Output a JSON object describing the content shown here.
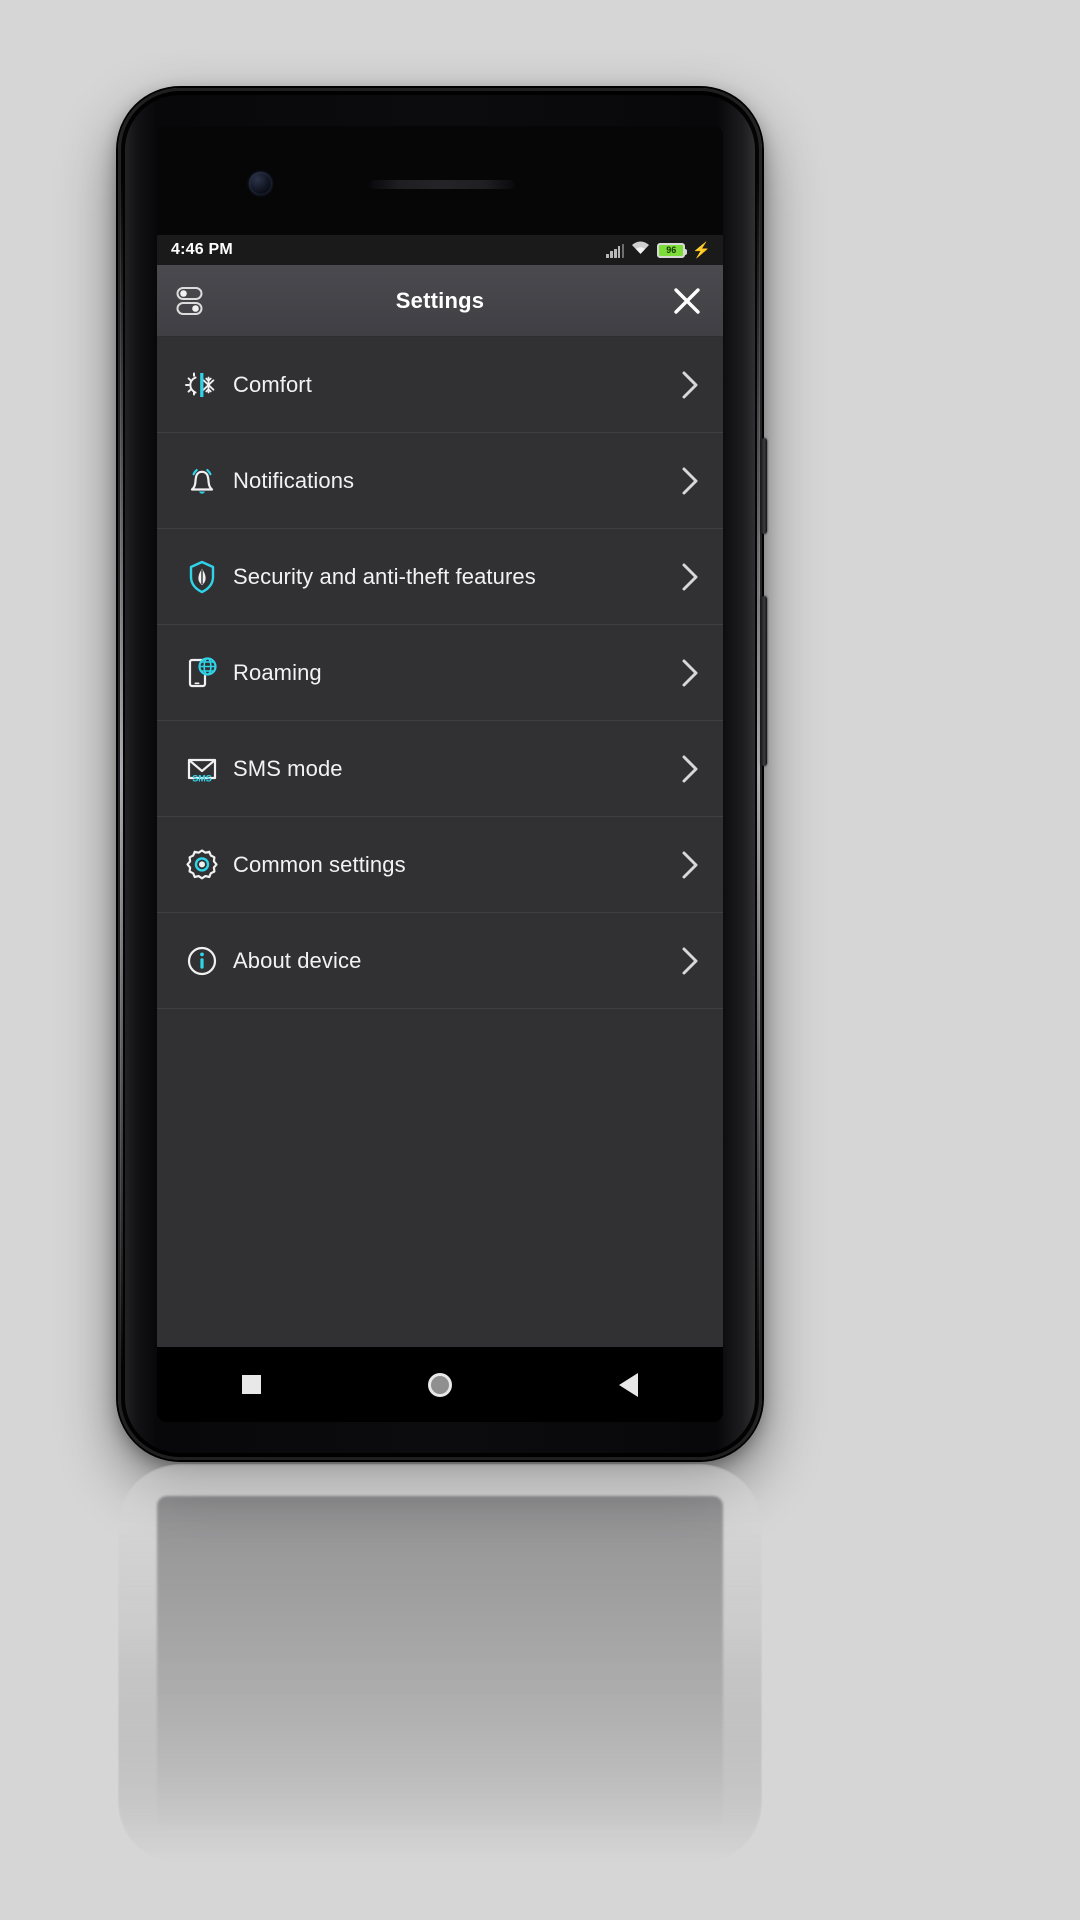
{
  "statusbar": {
    "time": "4:46 PM",
    "signal_icon": "signal-bars-icon",
    "wifi_icon": "wifi-icon",
    "battery_level": "96",
    "battery_icon": "battery-icon",
    "charging_icon": "charging-bolt-icon",
    "charging_glyph": "⚡",
    "battery_color": "#7ddc3a"
  },
  "header": {
    "title": "Settings",
    "leading_icon": "toggles-icon",
    "close_icon": "close-x-icon",
    "accent_color": "#2fd4e8",
    "bar_color": "#45454a"
  },
  "list": {
    "chevron_icon": "chevron-right-icon",
    "items": [
      {
        "label": "Comfort",
        "icon": "sun-snowflake-icon"
      },
      {
        "label": "Notifications",
        "icon": "bell-icon"
      },
      {
        "label": "Security and anti-theft features",
        "icon": "shield-icon"
      },
      {
        "label": "Roaming",
        "icon": "phone-globe-icon"
      },
      {
        "label": "SMS mode",
        "icon": "envelope-sms-icon",
        "badge": "SMS"
      },
      {
        "label": "Common settings",
        "icon": "gear-icon"
      },
      {
        "label": "About device",
        "icon": "info-circle-icon",
        "badge": "i"
      }
    ]
  },
  "navbar": {
    "recents_label": "recents-square-icon",
    "home_label": "home-circle-icon",
    "back_label": "back-triangle-icon"
  }
}
